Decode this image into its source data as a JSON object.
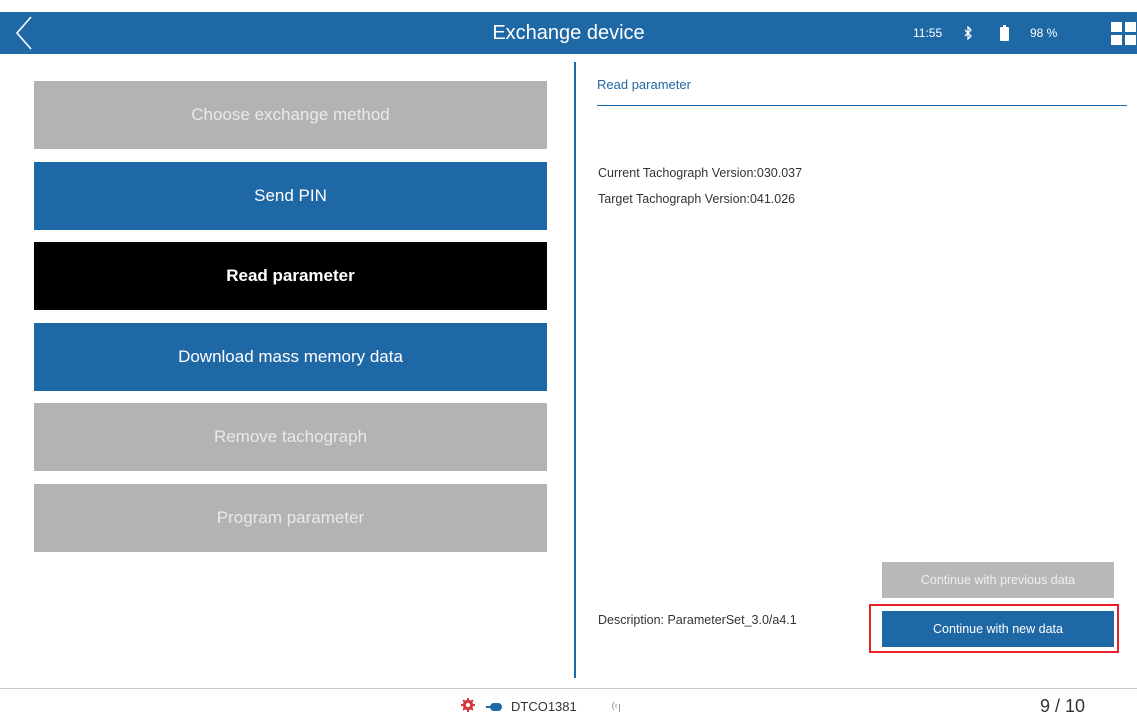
{
  "header": {
    "title": "Exchange device",
    "time": "11:55",
    "battery": "98 %",
    "back_icon": "chevron-left-icon",
    "bluetooth_icon": "bluetooth-icon",
    "battery_icon": "battery-icon",
    "apps_icon": "grid-icon",
    "color": "#1f68a6"
  },
  "steps": [
    {
      "label": "Choose exchange method",
      "state": "disabled"
    },
    {
      "label": "Send PIN",
      "state": "done"
    },
    {
      "label": "Read parameter",
      "state": "current"
    },
    {
      "label": "Download mass memory data",
      "state": "done"
    },
    {
      "label": "Remove tachograph",
      "state": "disabled"
    },
    {
      "label": "Program parameter",
      "state": "disabled"
    }
  ],
  "panel": {
    "title": "Read parameter",
    "current_version": "Current Tachograph Version:030.037",
    "target_version": "Target Tachograph Version:041.026",
    "description": "Description: ParameterSet_3.0/a4.1",
    "btn_previous": "Continue with previous data",
    "btn_new": "Continue with new data"
  },
  "footer": {
    "device": "DTCO1381",
    "page": "9 / 10",
    "gear_icon": "gear-icon",
    "plug_icon": "plug-icon",
    "signal_icon": "signal-icon"
  }
}
